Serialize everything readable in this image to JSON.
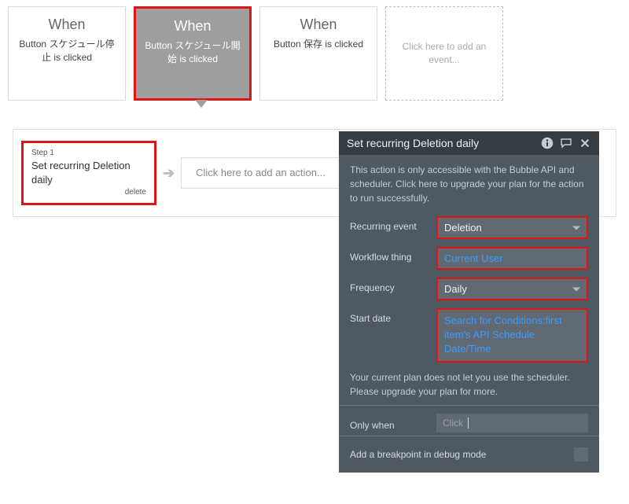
{
  "events": [
    {
      "when": "When",
      "label": "Button スケジュール停止 is clicked"
    },
    {
      "when": "When",
      "label": "Button スケジュール開始 is clicked",
      "selected": true
    },
    {
      "when": "When",
      "label": "Button 保存 is clicked"
    }
  ],
  "add_event_prompt": "Click here to add an event...",
  "actions": {
    "step1": {
      "step": "Step 1",
      "title": "Set recurring Deletion daily",
      "type": "delete"
    },
    "add_action_prompt": "Click here to add an action..."
  },
  "editor": {
    "title": "Set recurring Deletion daily",
    "note": "This action is only accessible with the Bubble API and scheduler. Click here to upgrade your plan for the action to run successfully.",
    "fields": {
      "recurring_event": {
        "label": "Recurring event",
        "value": "Deletion"
      },
      "workflow_thing": {
        "label": "Workflow thing",
        "value": "Current User"
      },
      "frequency": {
        "label": "Frequency",
        "value": "Daily"
      },
      "start_date": {
        "label": "Start date",
        "value": "Search for Conditions:first item's API Schedule Date/Time"
      }
    },
    "warn": "Your current plan does not let you use the scheduler. Please upgrade your plan for more.",
    "only_when_label": "Only when",
    "only_when_value": "Click",
    "breakpoint_label": "Add a breakpoint in debug mode"
  }
}
